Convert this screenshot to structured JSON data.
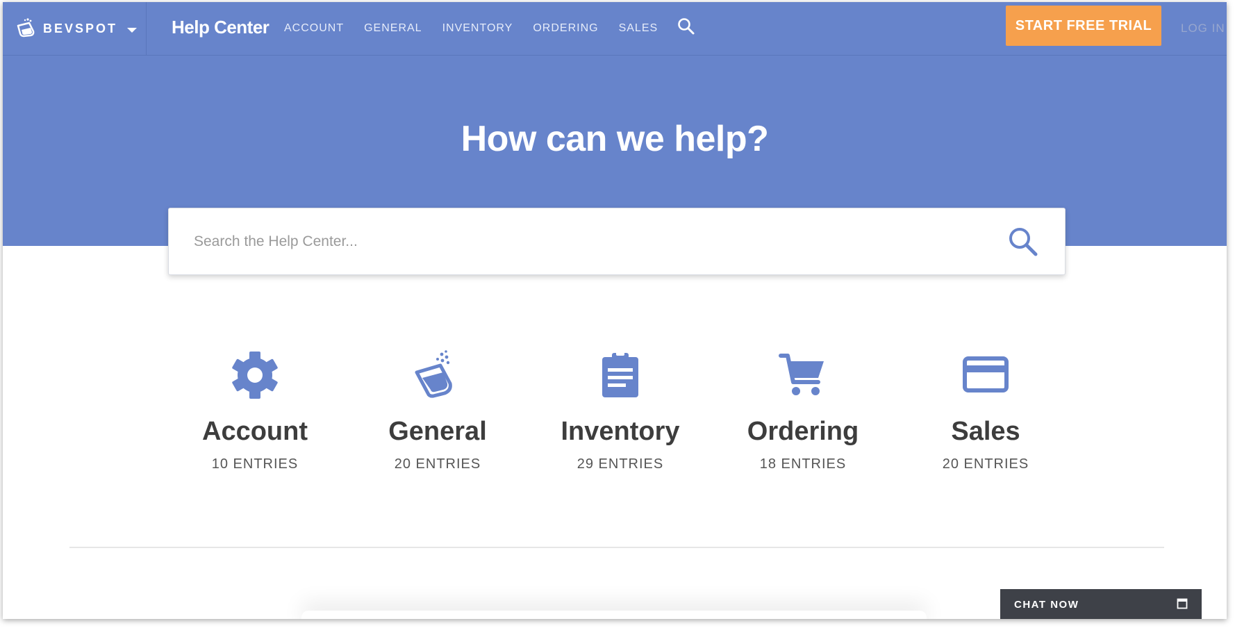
{
  "header": {
    "brand": "BEVSPOT",
    "section_title": "Help Center",
    "nav": [
      {
        "label": "ACCOUNT"
      },
      {
        "label": "GENERAL"
      },
      {
        "label": "INVENTORY"
      },
      {
        "label": "ORDERING"
      },
      {
        "label": "SALES"
      }
    ],
    "cta_label": "START FREE TRIAL",
    "login_label": "LOG IN"
  },
  "hero": {
    "title": "How can we help?",
    "search_placeholder": "Search the Help Center..."
  },
  "categories": [
    {
      "name": "Account",
      "count": "10 ENTRIES",
      "icon": "gear-icon"
    },
    {
      "name": "General",
      "count": "20 ENTRIES",
      "icon": "pour-icon"
    },
    {
      "name": "Inventory",
      "count": "29 ENTRIES",
      "icon": "clipboard-icon"
    },
    {
      "name": "Ordering",
      "count": "18 ENTRIES",
      "icon": "cart-icon"
    },
    {
      "name": "Sales",
      "count": "20 ENTRIES",
      "icon": "credit-card-icon"
    }
  ],
  "chat": {
    "label": "CHAT NOW"
  },
  "colors": {
    "brand_blue": "#6784cb",
    "cta_orange": "#f6a04d",
    "icon_blue": "#6784cb",
    "chat_dark": "#3e4148"
  }
}
